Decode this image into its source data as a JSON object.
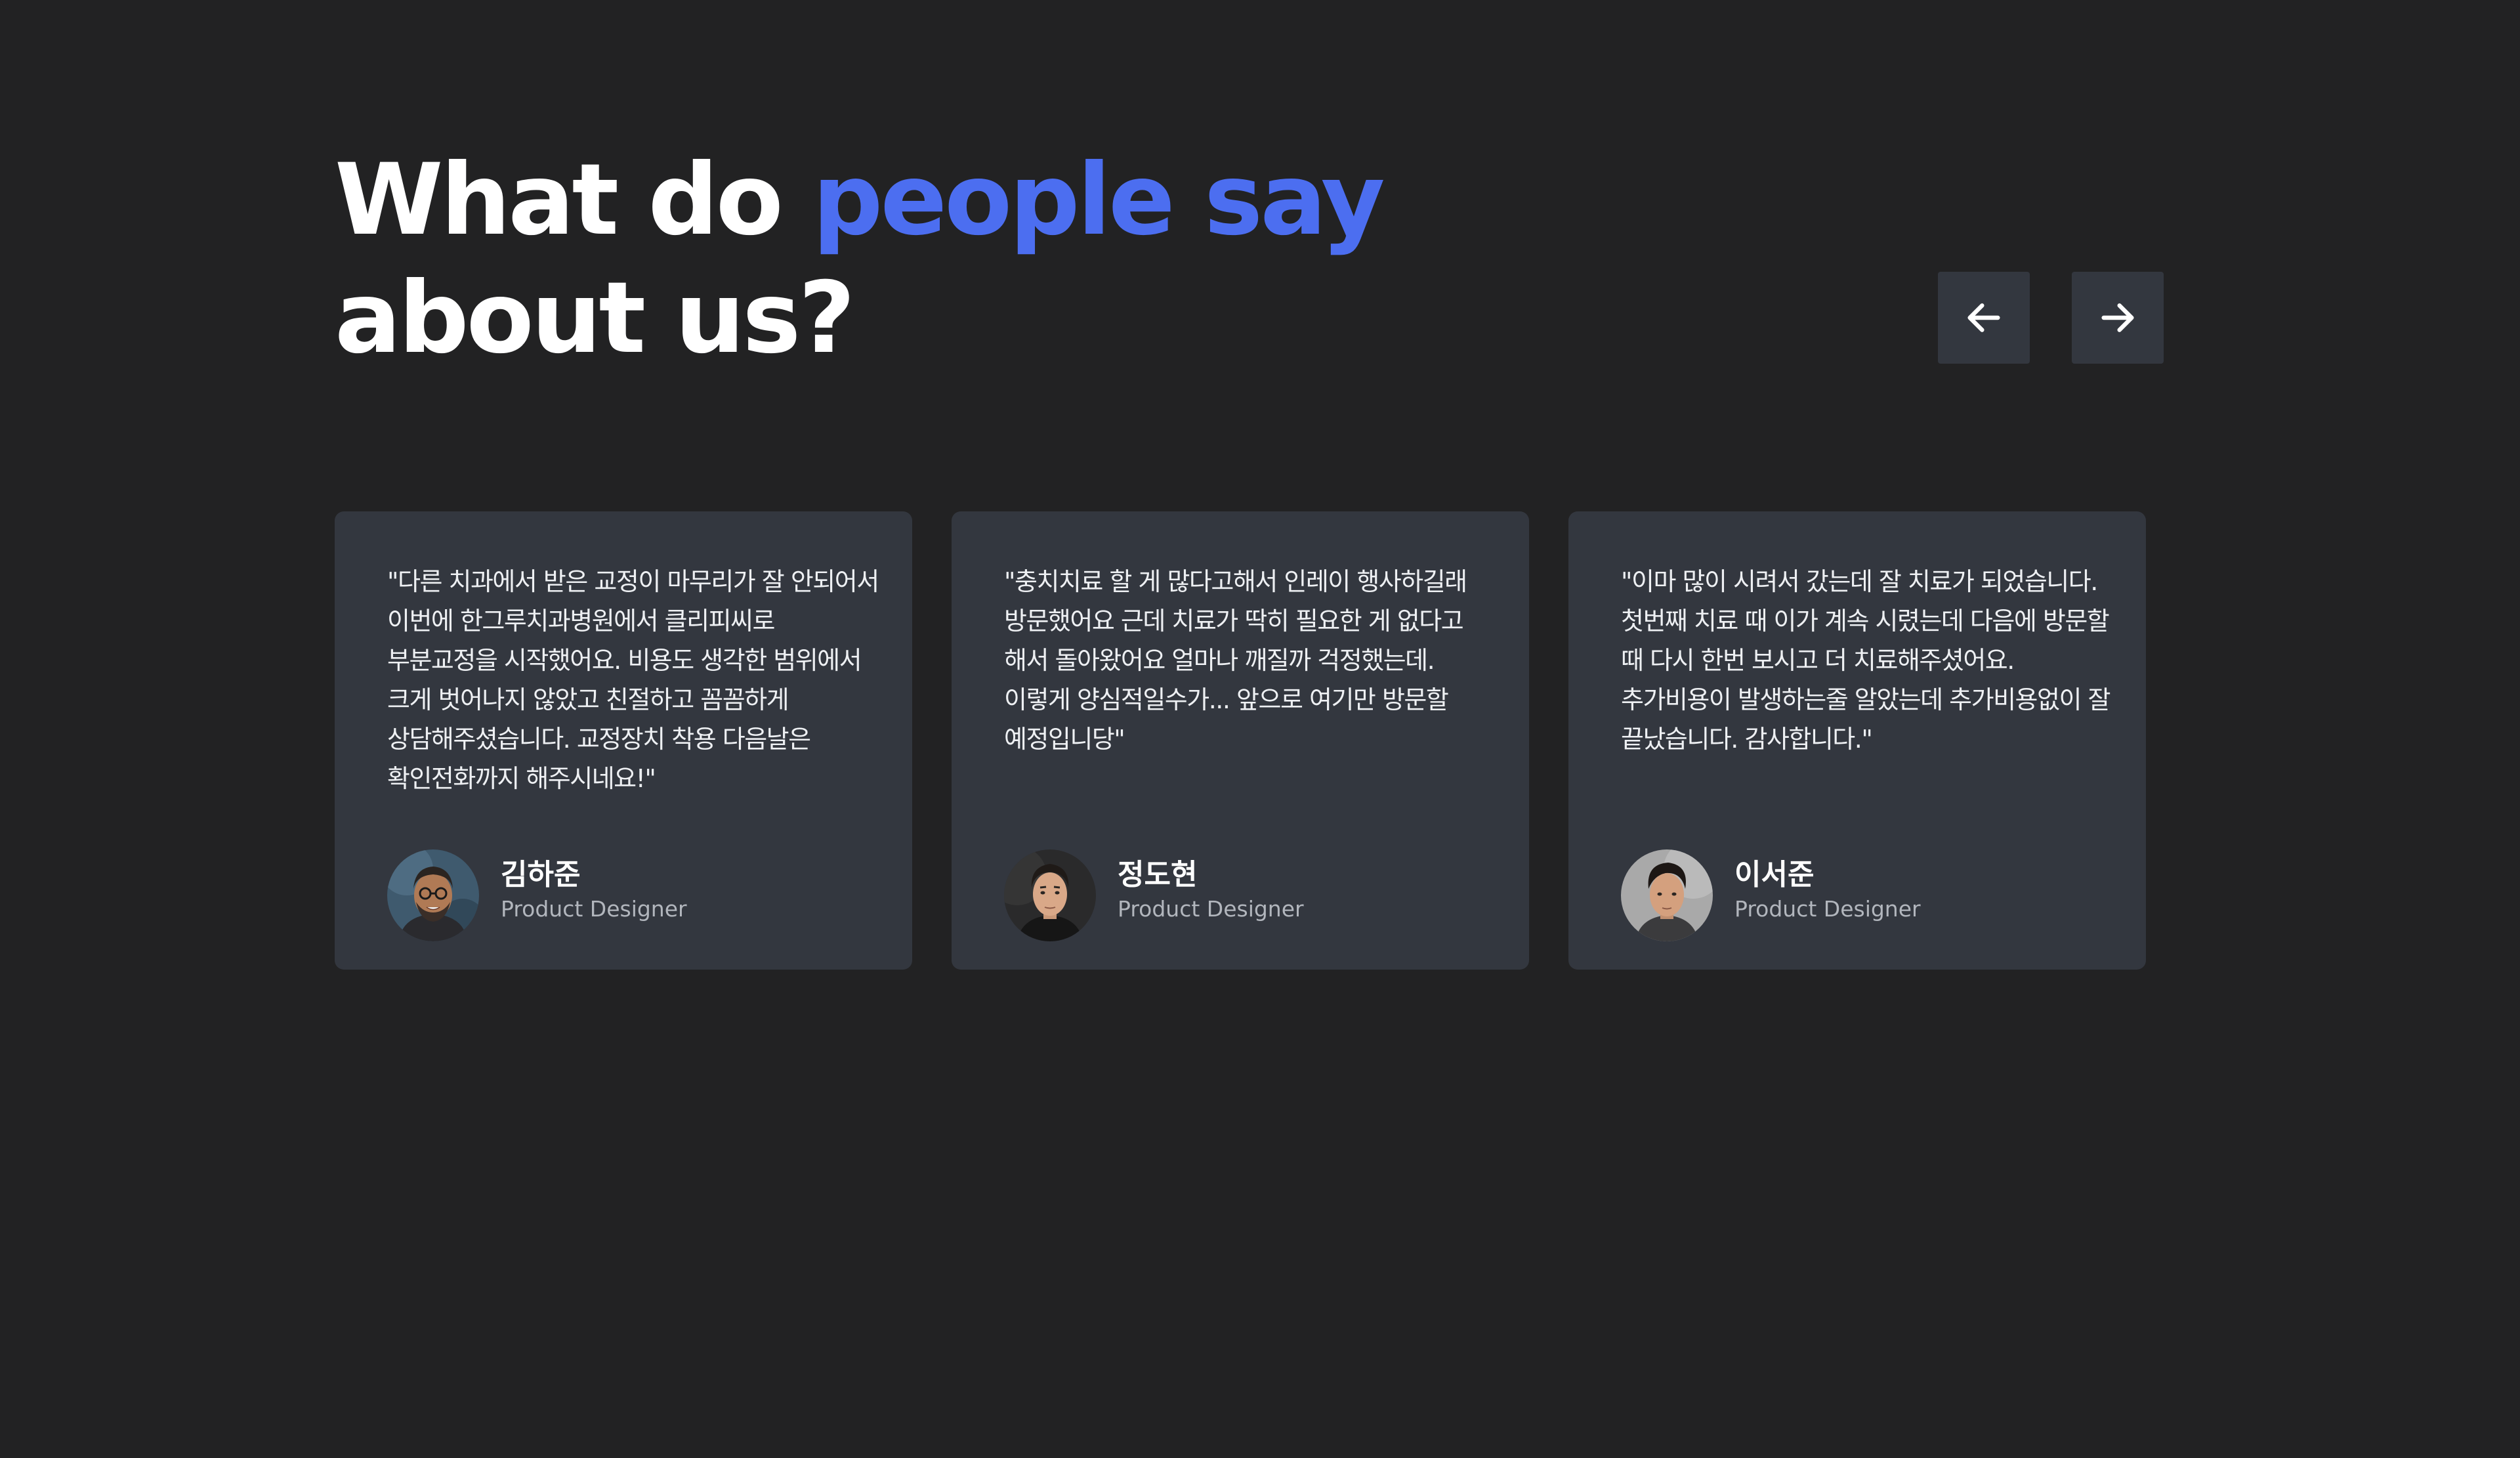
{
  "header": {
    "title_part1": "What do ",
    "title_accent": "people say",
    "title_part2": "about us?",
    "accent_color": "#4c6ef0"
  },
  "navigation": {
    "prev_icon": "arrow-left-icon",
    "next_icon": "arrow-right-icon"
  },
  "testimonials": [
    {
      "quote": "\"다른 치과에서 받은 교정이 마무리가 잘 안되어서 이번에 한그루치과병원에서 클리피씨로 부분교정을 시작했어요. 비용도 생각한 범위에서 크게 벗어나지 않았고 친절하고 꼼꼼하게 상담해주셨습니다. 교정장치 착용 다음날은 확인전화까지 해주시네요!\"",
      "name": "김하준",
      "role": "Product Designer",
      "avatar_icon": "avatar-photo"
    },
    {
      "quote": "\"충치치료 할 게 많다고해서 인레이 행사하길래 방문했어요 근데 치료가 딱히 필요한 게 없다고 해서 돌아왔어요 얼마나 깨질까 걱정했는데.이렇게 양심적일수가... 앞으로 여기만 방문할 예정입니당\"",
      "name": "정도현",
      "role": "Product Designer",
      "avatar_icon": "avatar-photo"
    },
    {
      "quote": "\"이마 많이 시려서 갔는데 잘 치료가 되었습니다. 첫번째 치료 때 이가 계속 시렸는데 다음에 방문할 때 다시 한번 보시고 더 치료해주셨어요. 추가비용이 발생하는줄 알았는데 추가비용없이 잘 끝났습니다. 감사합니다.\"",
      "name": "이서준",
      "role": "Product Designer",
      "avatar_icon": "avatar-photo"
    }
  ]
}
